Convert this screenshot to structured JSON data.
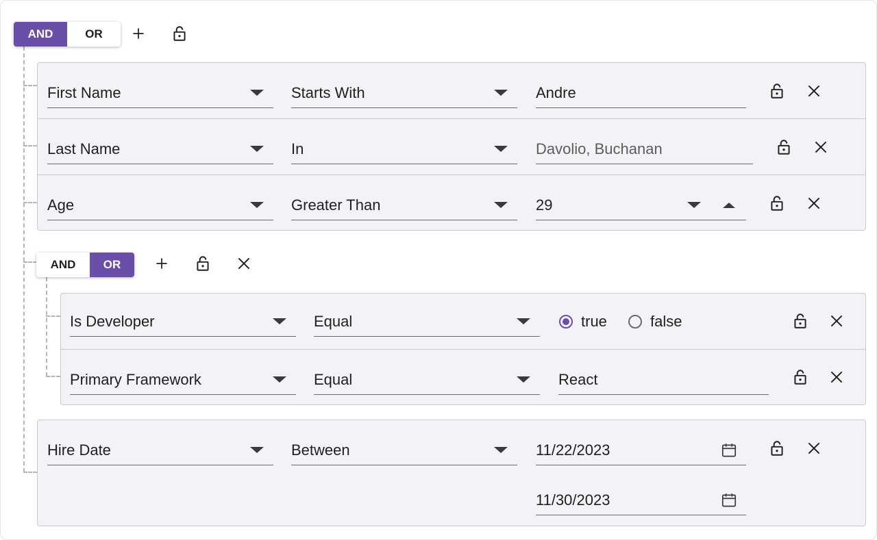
{
  "colors": {
    "accent": "#6a4ea8",
    "group_bg": "#f3f2f7",
    "border": "#c9c8cf"
  },
  "root": {
    "combinator": {
      "and_label": "AND",
      "or_label": "OR",
      "selected": "AND"
    },
    "actions": [
      "plus-icon",
      "lock-open-icon"
    ]
  },
  "rules": [
    {
      "field": "First Name",
      "operator": "Starts With",
      "value": "Andre"
    },
    {
      "field": "Last Name",
      "operator": "In",
      "value": "Davolio, Buchanan"
    },
    {
      "field": "Age",
      "operator": "Greater Than",
      "value": "29"
    }
  ],
  "subgroup": {
    "combinator": {
      "and_label": "AND",
      "or_label": "OR",
      "selected": "OR"
    },
    "actions": [
      "plus-icon",
      "lock-open-icon",
      "close-icon"
    ],
    "rules": [
      {
        "field": "Is Developer",
        "operator": "Equal",
        "options": [
          "true",
          "false"
        ],
        "selected": "true"
      },
      {
        "field": "Primary Framework",
        "operator": "Equal",
        "value": "React"
      }
    ]
  },
  "date_rule": {
    "field": "Hire Date",
    "operator": "Between",
    "from": "11/22/2023",
    "to": "11/30/2023"
  }
}
